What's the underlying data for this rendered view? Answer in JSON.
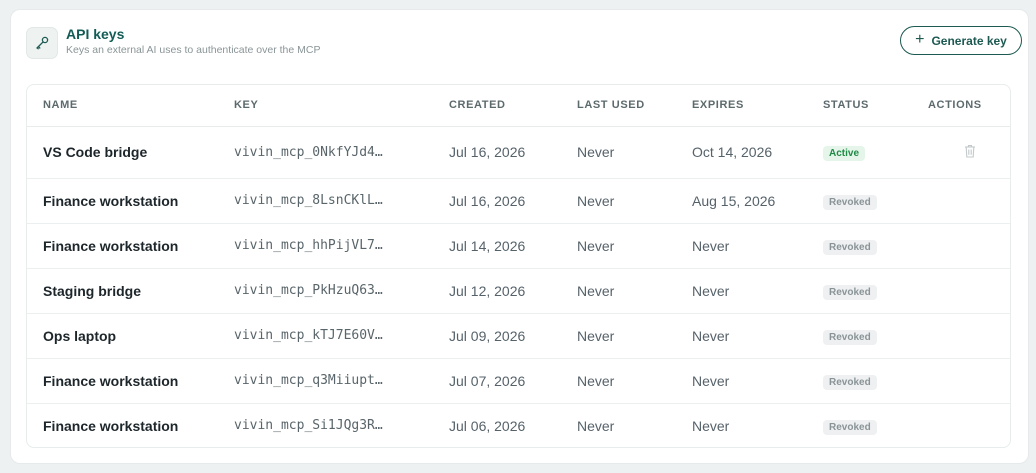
{
  "header": {
    "title": "API keys",
    "subtitle": "Keys an external AI uses to authenticate over the MCP",
    "icon": "key-icon",
    "generate_label": "Generate key"
  },
  "table": {
    "columns": [
      "NAME",
      "KEY",
      "CREATED",
      "LAST USED",
      "EXPIRES",
      "STATUS",
      "ACTIONS"
    ],
    "rows": [
      {
        "name": "VS Code bridge",
        "key": "vivin_mcp_0NkfYJd4…",
        "created": "Jul 16, 2026",
        "last_used": "Never",
        "expires": "Oct 14, 2026",
        "status": "Active",
        "action": "trash-icon"
      },
      {
        "name": "Finance workstation",
        "key": "vivin_mcp_8LsnCKlL…",
        "created": "Jul 16, 2026",
        "last_used": "Never",
        "expires": "Aug 15, 2026",
        "status": "Revoked"
      },
      {
        "name": "Finance workstation",
        "key": "vivin_mcp_hhPijVL7…",
        "created": "Jul 14, 2026",
        "last_used": "Never",
        "expires": "Never",
        "status": "Revoked"
      },
      {
        "name": "Staging bridge",
        "key": "vivin_mcp_PkHzuQ63…",
        "created": "Jul 12, 2026",
        "last_used": "Never",
        "expires": "Never",
        "status": "Revoked"
      },
      {
        "name": "Ops laptop",
        "key": "vivin_mcp_kTJ7E60V…",
        "created": "Jul 09, 2026",
        "last_used": "Never",
        "expires": "Never",
        "status": "Revoked"
      },
      {
        "name": "Finance workstation",
        "key": "vivin_mcp_q3Miiupt…",
        "created": "Jul 07, 2026",
        "last_used": "Never",
        "expires": "Never",
        "status": "Revoked"
      },
      {
        "name": "Finance workstation",
        "key": "vivin_mcp_Si1JQg3R…",
        "created": "Jul 06, 2026",
        "last_used": "Never",
        "expires": "Never",
        "status": "Revoked"
      }
    ]
  },
  "colors": {
    "accent": "#135c55",
    "active_text": "#1f8a45",
    "active_bg": "#e5f5ea",
    "revoked_text": "#8a9497",
    "revoked_bg": "#eef0f1"
  }
}
